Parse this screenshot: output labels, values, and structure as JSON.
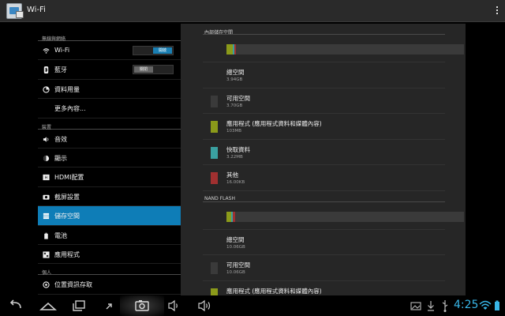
{
  "app": {
    "title": "Wi-Fi",
    "icon": "wifi-settings-app-icon"
  },
  "left": {
    "sections": [
      {
        "label": "無線與網絡"
      },
      {
        "label": "裝置"
      },
      {
        "label": "個人"
      }
    ],
    "items": [
      {
        "label": "Wi-Fi",
        "icon": "wifi-icon",
        "toggle_label": "開啟",
        "toggle_state": "on"
      },
      {
        "label": "藍牙",
        "icon": "bluetooth-icon",
        "toggle_label": "關閉",
        "toggle_state": "off"
      },
      {
        "label": "資料用量",
        "icon": "data-usage-icon"
      },
      {
        "label": "更多內容..."
      },
      {
        "label": "音效",
        "icon": "volume-icon"
      },
      {
        "label": "顯示",
        "icon": "display-icon"
      },
      {
        "label": "HDMI配置",
        "icon": "hdmi-icon"
      },
      {
        "label": "截屏設置",
        "icon": "screenshot-icon"
      },
      {
        "label": "儲存空間",
        "icon": "storage-icon",
        "selected": true
      },
      {
        "label": "電池",
        "icon": "battery-icon"
      },
      {
        "label": "應用程式",
        "icon": "apps-icon"
      },
      {
        "label": "位置資訊存取",
        "icon": "location-icon"
      }
    ]
  },
  "right": {
    "internal": {
      "header": "內部儲存空間",
      "usage_segments": [
        {
          "color": "#8b9a1a",
          "fraction": 0.025
        },
        {
          "color": "#3aa0a0",
          "fraction": 0.008
        },
        {
          "color": "#a03030",
          "fraction": 0.008
        }
      ],
      "rows": [
        {
          "name": "總空間",
          "size": "3.94GB",
          "color": ""
        },
        {
          "name": "可用空間",
          "size": "3.70GB",
          "color": "#3a3a3a"
        },
        {
          "name": "應用程式 (應用程式資料和媒體內容)",
          "size": "103MB",
          "color": "#8b9a1a"
        },
        {
          "name": "快取資料",
          "size": "3.22MB",
          "color": "#3aa0a0"
        },
        {
          "name": "其他",
          "size": "16.00KB",
          "color": "#a03030"
        }
      ]
    },
    "nand": {
      "header": "NAND FLASH",
      "usage_segments": [
        {
          "color": "#8b9a1a",
          "fraction": 0.02
        },
        {
          "color": "#3aa0a0",
          "fraction": 0.008
        },
        {
          "color": "#a03030",
          "fraction": 0.008
        }
      ],
      "rows": [
        {
          "name": "總空間",
          "size": "10.06GB",
          "color": ""
        },
        {
          "name": "可用空間",
          "size": "10.06GB",
          "color": "#3a3a3a"
        },
        {
          "name": "應用程式 (應用程式資料和媒體內容)",
          "size": "",
          "color": "#8b9a1a"
        }
      ]
    }
  },
  "status": {
    "time": "4:25"
  },
  "colors": {
    "accent": "#0e7db7",
    "clock": "#38b6e8"
  }
}
